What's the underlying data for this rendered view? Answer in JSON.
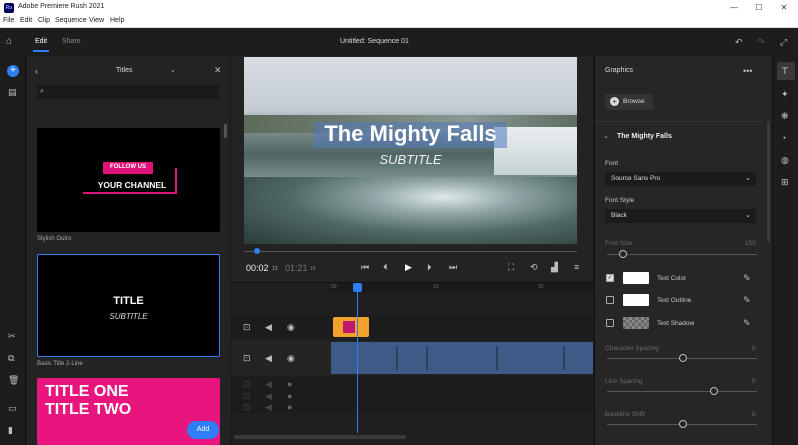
{
  "app": {
    "logo": "Ru",
    "title": "Adobe Premiere Rush 2021"
  },
  "window_controls": {
    "minimize": "—",
    "maximize": "☐",
    "close": "✕"
  },
  "menu": [
    "File",
    "Edit",
    "Clip",
    "Sequence",
    "View",
    "Help"
  ],
  "top": {
    "tab_edit": "Edit",
    "tab_share": "Share",
    "sequence_title": "Untitled: Sequence 01"
  },
  "titles_panel": {
    "header": "Titles",
    "items": [
      {
        "label": "Stylish Outro",
        "line1": "FOLLOW US",
        "line2": "YOUR CHANNEL"
      },
      {
        "label": "Basic Title 2-Line",
        "line1": "TITLE",
        "line2": "SUBTITLE"
      },
      {
        "label": "",
        "line1": "TITLE ONE",
        "line2": "TITLE TWO"
      }
    ],
    "add_button": "Add"
  },
  "viewer": {
    "title_text": "The Mighty Falls",
    "subtitle_text": "SUBTITLE",
    "timecode_current": "00:02",
    "timecode_current_frames": "13",
    "timecode_total": "01:21",
    "timecode_total_frames": "18",
    "progress": 0.04
  },
  "timeline": {
    "ruler": [
      "00",
      "15",
      "30"
    ],
    "playhead_fraction": 0.1
  },
  "graphics": {
    "header": "Graphics",
    "browse": "Browse",
    "section": "The Mighty Falls",
    "font_label": "Font",
    "font_value": "Source Sans Pro",
    "font_style_label": "Font Style",
    "font_style_value": "Black",
    "font_size_label": "Font Size",
    "font_size_value": "150",
    "text_color_label": "Text Color",
    "text_outline_label": "Text Outline",
    "text_shadow_label": "Text Shadow",
    "char_spacing_label": "Character Spacing",
    "char_spacing_value": "0",
    "line_spacing_label": "Line Spacing",
    "line_spacing_value": "0",
    "baseline_label": "Baseline Shift",
    "baseline_value": "0",
    "text_color_checked": true,
    "text_outline_checked": false,
    "text_shadow_checked": false
  },
  "colors": {
    "accent": "#2d7ef7",
    "clip_blue": "#3e5a86",
    "title_clip": "#f0a22d",
    "pink": "#e0137a"
  }
}
